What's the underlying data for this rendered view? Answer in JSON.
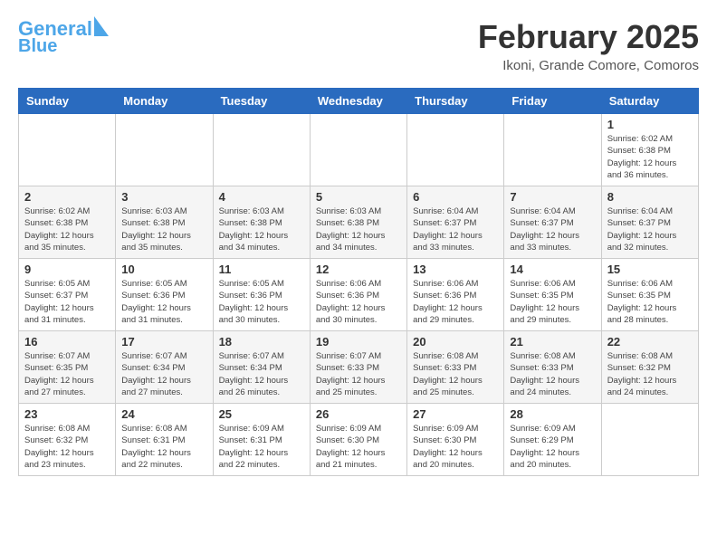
{
  "logo": {
    "line1": "General",
    "line2": "Blue"
  },
  "title": "February 2025",
  "location": "Ikoni, Grande Comore, Comoros",
  "weekdays": [
    "Sunday",
    "Monday",
    "Tuesday",
    "Wednesday",
    "Thursday",
    "Friday",
    "Saturday"
  ],
  "weeks": [
    [
      {
        "day": "",
        "info": ""
      },
      {
        "day": "",
        "info": ""
      },
      {
        "day": "",
        "info": ""
      },
      {
        "day": "",
        "info": ""
      },
      {
        "day": "",
        "info": ""
      },
      {
        "day": "",
        "info": ""
      },
      {
        "day": "1",
        "info": "Sunrise: 6:02 AM\nSunset: 6:38 PM\nDaylight: 12 hours\nand 36 minutes."
      }
    ],
    [
      {
        "day": "2",
        "info": "Sunrise: 6:02 AM\nSunset: 6:38 PM\nDaylight: 12 hours\nand 35 minutes."
      },
      {
        "day": "3",
        "info": "Sunrise: 6:03 AM\nSunset: 6:38 PM\nDaylight: 12 hours\nand 35 minutes."
      },
      {
        "day": "4",
        "info": "Sunrise: 6:03 AM\nSunset: 6:38 PM\nDaylight: 12 hours\nand 34 minutes."
      },
      {
        "day": "5",
        "info": "Sunrise: 6:03 AM\nSunset: 6:38 PM\nDaylight: 12 hours\nand 34 minutes."
      },
      {
        "day": "6",
        "info": "Sunrise: 6:04 AM\nSunset: 6:37 PM\nDaylight: 12 hours\nand 33 minutes."
      },
      {
        "day": "7",
        "info": "Sunrise: 6:04 AM\nSunset: 6:37 PM\nDaylight: 12 hours\nand 33 minutes."
      },
      {
        "day": "8",
        "info": "Sunrise: 6:04 AM\nSunset: 6:37 PM\nDaylight: 12 hours\nand 32 minutes."
      }
    ],
    [
      {
        "day": "9",
        "info": "Sunrise: 6:05 AM\nSunset: 6:37 PM\nDaylight: 12 hours\nand 31 minutes."
      },
      {
        "day": "10",
        "info": "Sunrise: 6:05 AM\nSunset: 6:36 PM\nDaylight: 12 hours\nand 31 minutes."
      },
      {
        "day": "11",
        "info": "Sunrise: 6:05 AM\nSunset: 6:36 PM\nDaylight: 12 hours\nand 30 minutes."
      },
      {
        "day": "12",
        "info": "Sunrise: 6:06 AM\nSunset: 6:36 PM\nDaylight: 12 hours\nand 30 minutes."
      },
      {
        "day": "13",
        "info": "Sunrise: 6:06 AM\nSunset: 6:36 PM\nDaylight: 12 hours\nand 29 minutes."
      },
      {
        "day": "14",
        "info": "Sunrise: 6:06 AM\nSunset: 6:35 PM\nDaylight: 12 hours\nand 29 minutes."
      },
      {
        "day": "15",
        "info": "Sunrise: 6:06 AM\nSunset: 6:35 PM\nDaylight: 12 hours\nand 28 minutes."
      }
    ],
    [
      {
        "day": "16",
        "info": "Sunrise: 6:07 AM\nSunset: 6:35 PM\nDaylight: 12 hours\nand 27 minutes."
      },
      {
        "day": "17",
        "info": "Sunrise: 6:07 AM\nSunset: 6:34 PM\nDaylight: 12 hours\nand 27 minutes."
      },
      {
        "day": "18",
        "info": "Sunrise: 6:07 AM\nSunset: 6:34 PM\nDaylight: 12 hours\nand 26 minutes."
      },
      {
        "day": "19",
        "info": "Sunrise: 6:07 AM\nSunset: 6:33 PM\nDaylight: 12 hours\nand 25 minutes."
      },
      {
        "day": "20",
        "info": "Sunrise: 6:08 AM\nSunset: 6:33 PM\nDaylight: 12 hours\nand 25 minutes."
      },
      {
        "day": "21",
        "info": "Sunrise: 6:08 AM\nSunset: 6:33 PM\nDaylight: 12 hours\nand 24 minutes."
      },
      {
        "day": "22",
        "info": "Sunrise: 6:08 AM\nSunset: 6:32 PM\nDaylight: 12 hours\nand 24 minutes."
      }
    ],
    [
      {
        "day": "23",
        "info": "Sunrise: 6:08 AM\nSunset: 6:32 PM\nDaylight: 12 hours\nand 23 minutes."
      },
      {
        "day": "24",
        "info": "Sunrise: 6:08 AM\nSunset: 6:31 PM\nDaylight: 12 hours\nand 22 minutes."
      },
      {
        "day": "25",
        "info": "Sunrise: 6:09 AM\nSunset: 6:31 PM\nDaylight: 12 hours\nand 22 minutes."
      },
      {
        "day": "26",
        "info": "Sunrise: 6:09 AM\nSunset: 6:30 PM\nDaylight: 12 hours\nand 21 minutes."
      },
      {
        "day": "27",
        "info": "Sunrise: 6:09 AM\nSunset: 6:30 PM\nDaylight: 12 hours\nand 20 minutes."
      },
      {
        "day": "28",
        "info": "Sunrise: 6:09 AM\nSunset: 6:29 PM\nDaylight: 12 hours\nand 20 minutes."
      },
      {
        "day": "",
        "info": ""
      }
    ]
  ]
}
